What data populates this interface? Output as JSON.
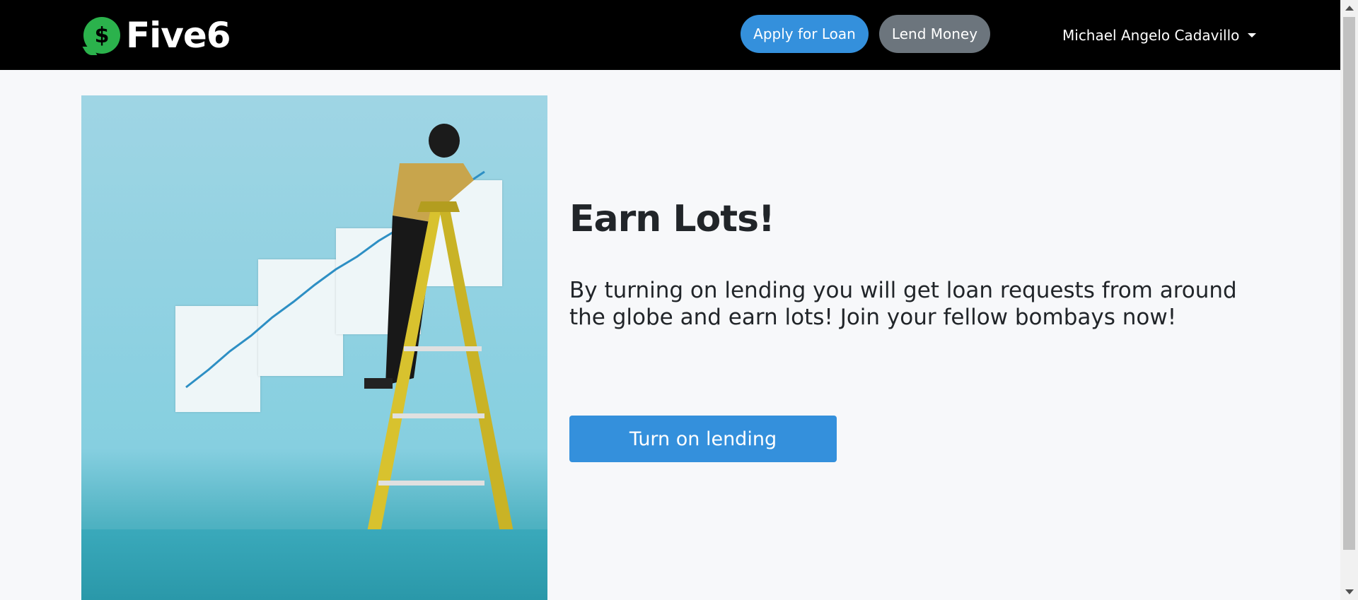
{
  "navbar": {
    "brand": "Five6",
    "logo_symbol": "$",
    "apply_button": "Apply for Loan",
    "lend_button": "Lend Money",
    "user_name": "Michael Angelo Cadavillo"
  },
  "main": {
    "headline": "Earn Lots!",
    "description": "By turning on lending you will get loan requests from around the globe and earn lots! Join your fellow bombays now!",
    "cta_label": "Turn on lending"
  },
  "colors": {
    "navbar_bg": "#000000",
    "primary": "#3490dc",
    "secondary": "#6c757d",
    "logo_green": "#2bb24c",
    "page_bg": "#f7f8fa"
  }
}
